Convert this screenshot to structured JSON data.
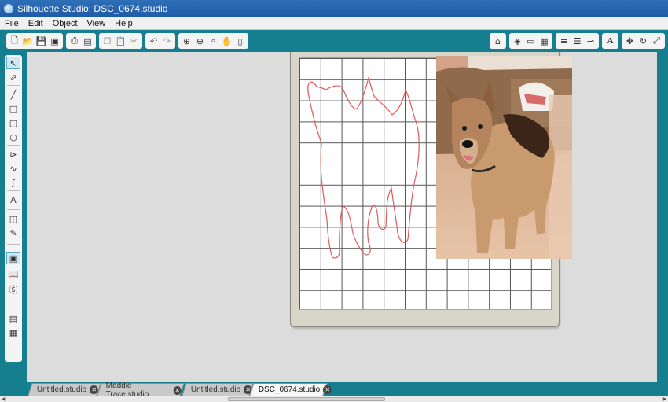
{
  "window": {
    "title": "Silhouette Studio: DSC_0674.studio"
  },
  "menu": [
    "File",
    "Edit",
    "Object",
    "View",
    "Help"
  ],
  "toolbar": {
    "left_icons": [
      "new-icon",
      "open-icon",
      "save-icon",
      "save-as-icon",
      "print-icon",
      "cut-print-icon",
      "copy-icon",
      "paste-icon",
      "cut-icon",
      "undo-icon",
      "redo-icon",
      "zoom-in-icon",
      "zoom-out-icon",
      "zoom-select-icon",
      "pan-icon",
      "fit-page-icon"
    ],
    "right_icons": [
      "send-to-cutter-icon",
      "fill-color-icon",
      "line-color-icon",
      "fill-pattern-icon",
      "line-style-icon",
      "line-weight-icon",
      "text-style-icon",
      "transform-icon",
      "rotate-icon",
      "scale-icon"
    ]
  },
  "left_tools": [
    "select-tool",
    "point-edit-tool",
    "line-tool",
    "rectangle-tool",
    "rounded-rect-tool",
    "ellipse-tool",
    "polygon-tool",
    "curve-tool",
    "freehand-tool",
    "text-tool",
    "eraser-tool",
    "knife-tool",
    "page-setup-tool",
    "library-tool",
    "store-tool",
    "settings-tool"
  ],
  "tabs": [
    {
      "label": "Untitled.studio",
      "active": false
    },
    {
      "label": "Maddie Trace.studio",
      "active": false
    },
    {
      "label": "Untitled.studio",
      "active": false
    },
    {
      "label": "DSC_0674.studio",
      "active": true
    }
  ],
  "colors": {
    "teal": "#157e8f",
    "trace": "#e05a5a"
  }
}
